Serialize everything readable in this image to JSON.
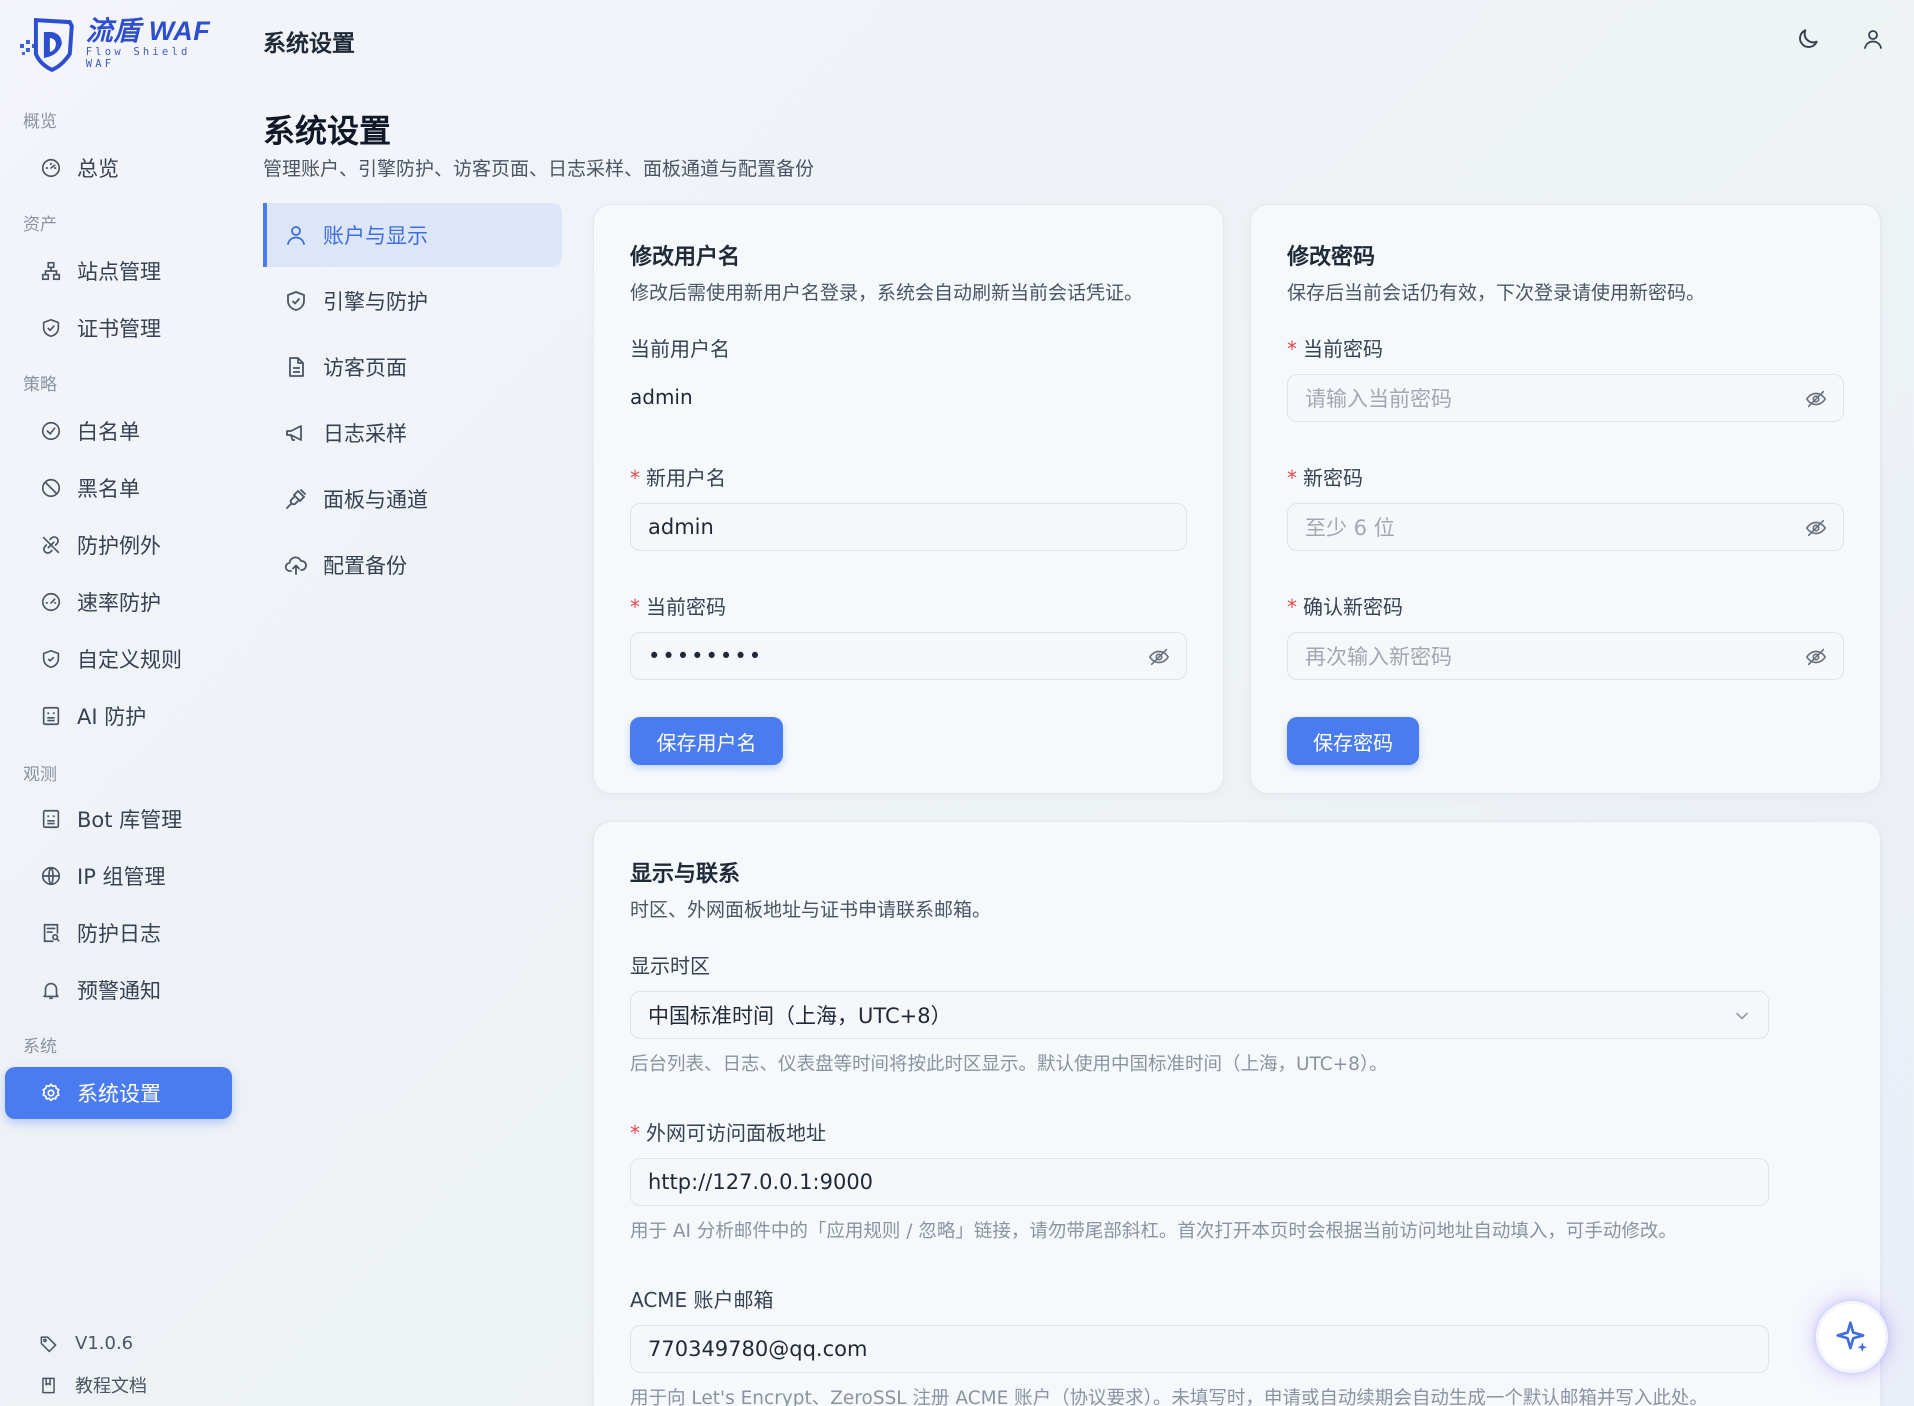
{
  "brand": {
    "name": "流盾 WAF",
    "tagline": "Flow Shield WAF"
  },
  "topbar": {
    "title": "系统设置",
    "theme_icon": "moon-icon",
    "user_icon": "user-icon"
  },
  "sidebar": {
    "groups": {
      "overview": "概览",
      "assets": "资产",
      "policy": "策略",
      "observe": "观测",
      "system": "系统"
    },
    "items": {
      "overview": "总览",
      "sites": "站点管理",
      "certs": "证书管理",
      "whitelist": "白名单",
      "blacklist": "黑名单",
      "exceptions": "防护例外",
      "ratelimit": "速率防护",
      "customrules": "自定义规则",
      "ai": "AI 防护",
      "bot": "Bot 库管理",
      "ipgroups": "IP 组管理",
      "logs": "防护日志",
      "alerts": "预警通知",
      "settings": "系统设置"
    },
    "footer": {
      "version": "V1.0.6",
      "docs": "教程文档"
    }
  },
  "page": {
    "title": "系统设置",
    "subtitle": "管理账户、引擎防护、访客页面、日志采样、面板通道与配置备份"
  },
  "subnav": {
    "account": "账户与显示",
    "engine": "引擎与防护",
    "visitor": "访客页面",
    "logging": "日志采样",
    "panel": "面板与通道",
    "backup": "配置备份"
  },
  "username_card": {
    "title": "修改用户名",
    "desc": "修改后需使用新用户名登录，系统会自动刷新当前会话凭证。",
    "current_label": "当前用户名",
    "current_value": "admin",
    "new_label": "新用户名",
    "new_value": "admin",
    "password_label": "当前密码",
    "password_value": "••••••••",
    "save": "保存用户名"
  },
  "password_card": {
    "title": "修改密码",
    "desc": "保存后当前会话仍有效，下次登录请使用新密码。",
    "current_label": "当前密码",
    "current_placeholder": "请输入当前密码",
    "new_label": "新密码",
    "new_placeholder": "至少 6 位",
    "confirm_label": "确认新密码",
    "confirm_placeholder": "再次输入新密码",
    "save": "保存密码"
  },
  "display_card": {
    "title": "显示与联系",
    "desc": "时区、外网面板地址与证书申请联系邮箱。",
    "tz_label": "显示时区",
    "tz_value": "中国标准时间（上海，UTC+8）",
    "tz_help": "后台列表、日志、仪表盘等时间将按此时区显示。默认使用中国标准时间（上海，UTC+8）。",
    "url_label": "外网可访问面板地址",
    "url_value": "http://127.0.0.1:9000",
    "url_help": "用于 AI 分析邮件中的「应用规则 / 忽略」链接，请勿带尾部斜杠。首次打开本页时会根据当前访问地址自动填入，可手动修改。",
    "email_label": "ACME 账户邮箱",
    "email_value": "770349780@qq.com",
    "email_help": "用于向 Let's Encrypt、ZeroSSL 注册 ACME 账户（协议要求）。未填写时，申请或自动续期会自动生成一个默认邮箱并写入此处。"
  },
  "colors": {
    "accent": "#4a7cf0",
    "required": "#e5484d",
    "active_subnav_bg": "#dde6f8"
  }
}
